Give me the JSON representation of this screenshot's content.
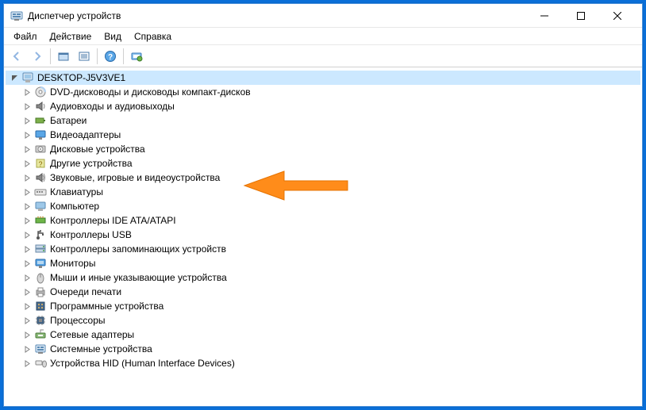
{
  "window": {
    "title": "Диспетчер устройств"
  },
  "menu": {
    "file": "Файл",
    "action": "Действие",
    "view": "Вид",
    "help": "Справка"
  },
  "tree": {
    "root": "DESKTOP-J5V3VE1",
    "items": [
      {
        "label": "DVD-дисководы и дисководы компакт-дисков",
        "icon": "disc"
      },
      {
        "label": "Аудиовходы и аудиовыходы",
        "icon": "audio"
      },
      {
        "label": "Батареи",
        "icon": "battery"
      },
      {
        "label": "Видеоадаптеры",
        "icon": "display"
      },
      {
        "label": "Дисковые устройства",
        "icon": "drive"
      },
      {
        "label": "Другие устройства",
        "icon": "other"
      },
      {
        "label": "Звуковые, игровые и видеоустройства",
        "icon": "sound"
      },
      {
        "label": "Клавиатуры",
        "icon": "keyboard"
      },
      {
        "label": "Компьютер",
        "icon": "computer"
      },
      {
        "label": "Контроллеры IDE ATA/ATAPI",
        "icon": "ide"
      },
      {
        "label": "Контроллеры USB",
        "icon": "usb"
      },
      {
        "label": "Контроллеры запоминающих устройств",
        "icon": "storage"
      },
      {
        "label": "Мониторы",
        "icon": "monitor"
      },
      {
        "label": "Мыши и иные указывающие устройства",
        "icon": "mouse"
      },
      {
        "label": "Очереди печати",
        "icon": "printer"
      },
      {
        "label": "Программные устройства",
        "icon": "software"
      },
      {
        "label": "Процессоры",
        "icon": "cpu"
      },
      {
        "label": "Сетевые адаптеры",
        "icon": "network"
      },
      {
        "label": "Системные устройства",
        "icon": "system"
      },
      {
        "label": "Устройства HID (Human Interface Devices)",
        "icon": "hid"
      }
    ]
  },
  "annotation": {
    "arrow_target_index": 6
  }
}
